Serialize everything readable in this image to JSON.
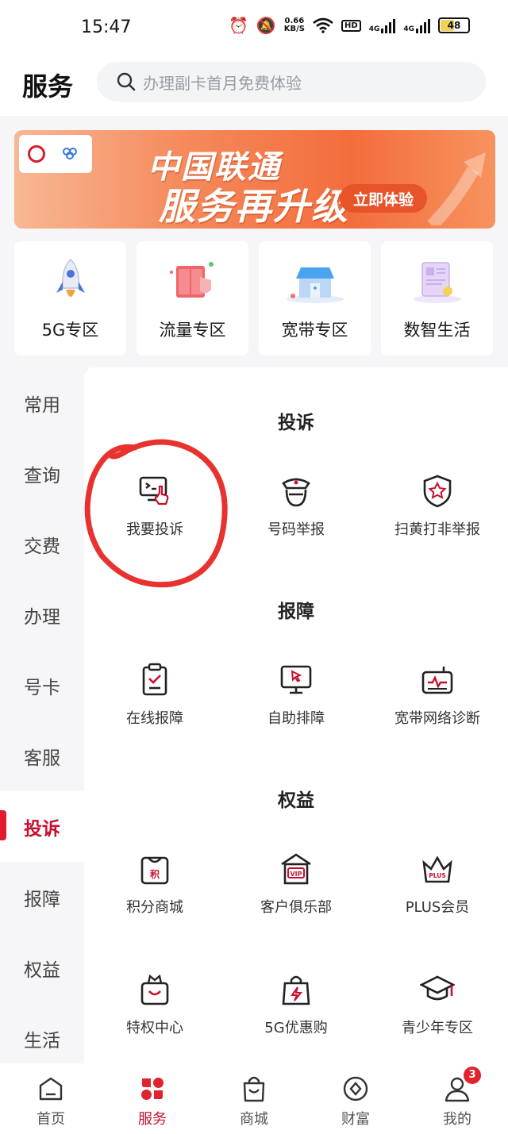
{
  "status_bar": {
    "time": "15:47",
    "speed_value": "0.66",
    "speed_unit": "KB/S",
    "hd": "HD",
    "net1": "4G",
    "net2": "4G",
    "battery": "48"
  },
  "header": {
    "title": "服务",
    "search_placeholder": "办理副卡首月免费体验"
  },
  "banner": {
    "line1": "中国联通",
    "line2": "服务再升级",
    "cta": "立即体验"
  },
  "quick_cards": [
    {
      "label": "5G专区",
      "icon": "rocket-icon"
    },
    {
      "label": "流量专区",
      "icon": "data-flow-icon"
    },
    {
      "label": "宽带专区",
      "icon": "broadband-house-icon"
    },
    {
      "label": "数智生活",
      "icon": "smart-life-icon"
    }
  ],
  "sidebar": {
    "items": [
      "常用",
      "查询",
      "交费",
      "办理",
      "号卡",
      "客服",
      "投诉",
      "报障",
      "权益",
      "生活"
    ],
    "active": "投诉"
  },
  "sections": [
    {
      "title": "投诉",
      "items": [
        {
          "label": "我要投诉",
          "icon": "complaint-monitor-icon"
        },
        {
          "label": "号码举报",
          "icon": "police-officer-icon"
        },
        {
          "label": "扫黄打非举报",
          "icon": "star-shield-icon"
        }
      ]
    },
    {
      "title": "报障",
      "items": [
        {
          "label": "在线报障",
          "icon": "clipboard-check-icon"
        },
        {
          "label": "自助排障",
          "icon": "monitor-cursor-icon"
        },
        {
          "label": "宽带网络诊断",
          "icon": "router-pulse-icon"
        }
      ]
    },
    {
      "title": "权益",
      "items": [
        {
          "label": "积分商城",
          "icon": "points-bag-icon"
        },
        {
          "label": "客户俱乐部",
          "icon": "vip-house-icon"
        },
        {
          "label": "PLUS会员",
          "icon": "plus-crown-icon"
        },
        {
          "label": "特权中心",
          "icon": "crown-bag-icon"
        },
        {
          "label": "5G优惠购",
          "icon": "lightning-bag-icon"
        },
        {
          "label": "青少年专区",
          "icon": "graduation-cap-icon"
        }
      ]
    }
  ],
  "bottom_nav": [
    {
      "label": "首页",
      "icon": "home-icon"
    },
    {
      "label": "服务",
      "icon": "service-clover-icon",
      "active": true
    },
    {
      "label": "商城",
      "icon": "shopping-bag-icon"
    },
    {
      "label": "财富",
      "icon": "wealth-coin-icon"
    },
    {
      "label": "我的",
      "icon": "profile-icon",
      "badge": "3"
    }
  ],
  "colors": {
    "accent": "#c8102e",
    "banner": "#f36d3c",
    "annotation": "#e8322f"
  }
}
